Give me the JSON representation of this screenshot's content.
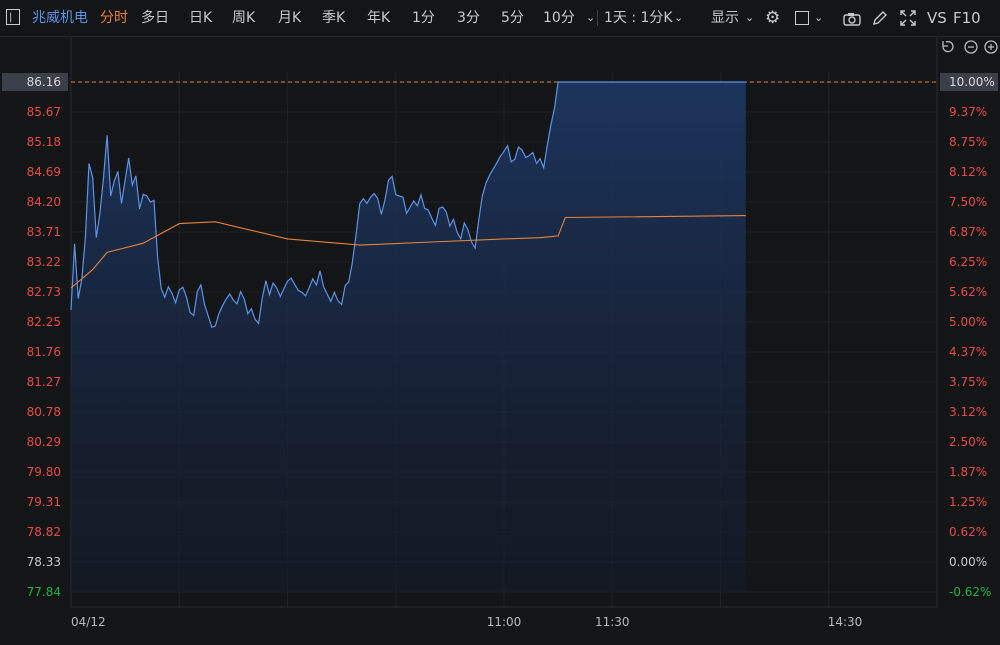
{
  "toolbar": {
    "stock_name": "兆威机电",
    "tabs": [
      "分时",
      "多日",
      "日K",
      "周K",
      "月K",
      "季K",
      "年K",
      "1分",
      "3分",
      "5分",
      "10分"
    ],
    "active_tab": "分时",
    "period_select": "1天 : 1分K",
    "display_label": "显示",
    "vs_label": "VS",
    "f10_label": "F10"
  },
  "colors": {
    "up": "#e84a4a",
    "down": "#22b14c",
    "neutral": "#c8c8c8",
    "price_line": "#5b93e6",
    "avg_line": "#e8813a",
    "limit_line": "#e8813a"
  },
  "chart_data": {
    "type": "line",
    "x_ticks": [
      "04/12",
      "11:00",
      "11:30",
      "14:30"
    ],
    "y_left_ticks": [
      "86.16",
      "85.67",
      "85.18",
      "84.69",
      "84.20",
      "83.71",
      "83.22",
      "82.73",
      "82.25",
      "81.76",
      "81.27",
      "80.78",
      "80.29",
      "79.80",
      "79.31",
      "78.82",
      "78.33",
      "77.84"
    ],
    "y_right_ticks": [
      "10.00%",
      "9.37%",
      "8.75%",
      "8.12%",
      "7.50%",
      "6.87%",
      "6.25%",
      "5.62%",
      "5.00%",
      "4.37%",
      "3.75%",
      "3.12%",
      "2.50%",
      "1.87%",
      "1.25%",
      "0.62%",
      "0.00%",
      "-0.62%"
    ],
    "ylim": [
      77.84,
      86.16
    ],
    "prev_close": 78.33,
    "limit_up": 86.16,
    "x_minutes_total": 240,
    "series": [
      {
        "kind": "price",
        "x": [
          0,
          1,
          2,
          3,
          4,
          5,
          6,
          7,
          8,
          9,
          10,
          11,
          12,
          13,
          14,
          15,
          16,
          17,
          18,
          19,
          20,
          21,
          22,
          23,
          24,
          25,
          26,
          27,
          28,
          29,
          30,
          31,
          32,
          33,
          34,
          35,
          36,
          37,
          38,
          39,
          40,
          41,
          42,
          43,
          44,
          45,
          46,
          47,
          48,
          49,
          50,
          51,
          52,
          53,
          54,
          55,
          56,
          57,
          58,
          59,
          60,
          61,
          62,
          63,
          64,
          65,
          66,
          67,
          68,
          69,
          70,
          71,
          72,
          73,
          74,
          75,
          76,
          77,
          78,
          79,
          80,
          81,
          82,
          83,
          84,
          85,
          86,
          87,
          88,
          89,
          90,
          91,
          92,
          93,
          94,
          95,
          96,
          97,
          98,
          99,
          100,
          101,
          102,
          103,
          104,
          105,
          106,
          107,
          108,
          109,
          110,
          111,
          112,
          113,
          114,
          115,
          116,
          117,
          118,
          119,
          120,
          121,
          122,
          123,
          124,
          125,
          126,
          127,
          128,
          129,
          130,
          131,
          132,
          133,
          134,
          135,
          136,
          137,
          138,
          139,
          140,
          141,
          142,
          143,
          144,
          145,
          146,
          147,
          148,
          149,
          150,
          151,
          152,
          153,
          154,
          155,
          156,
          157,
          158,
          159,
          160,
          161,
          162,
          163,
          164,
          165,
          166,
          167,
          168,
          169,
          170,
          171,
          172,
          173,
          174,
          175,
          176,
          177,
          178,
          179,
          180,
          181,
          182,
          183,
          184,
          185,
          186,
          187
        ],
        "values": [
          82.44,
          83.52,
          82.63,
          82.94,
          83.63,
          84.83,
          84.6,
          83.62,
          84.02,
          84.6,
          85.29,
          84.3,
          84.55,
          84.7,
          84.18,
          84.56,
          84.92,
          84.48,
          84.63,
          84.09,
          84.33,
          84.3,
          84.2,
          84.23,
          83.3,
          82.79,
          82.65,
          82.82,
          82.71,
          82.56,
          82.77,
          82.81,
          82.65,
          82.4,
          82.35,
          82.74,
          82.85,
          82.53,
          82.35,
          82.16,
          82.18,
          82.38,
          82.51,
          82.62,
          82.7,
          82.6,
          82.54,
          82.74,
          82.62,
          82.38,
          82.46,
          82.29,
          82.22,
          82.63,
          82.92,
          82.69,
          82.88,
          82.8,
          82.66,
          82.79,
          82.91,
          82.96,
          82.86,
          82.76,
          82.73,
          82.67,
          82.8,
          82.95,
          82.85,
          83.08,
          82.82,
          82.7,
          82.58,
          82.73,
          82.59,
          82.53,
          82.84,
          82.9,
          83.22,
          83.67,
          84.17,
          84.26,
          84.18,
          84.28,
          84.34,
          84.26,
          84.0,
          84.23,
          84.56,
          84.62,
          84.32,
          84.3,
          84.28,
          84.02,
          84.12,
          84.22,
          84.14,
          84.32,
          84.1,
          84.07,
          83.94,
          83.82,
          84.1,
          84.12,
          84.04,
          83.81,
          83.92,
          83.71,
          83.6,
          83.86,
          83.75,
          83.55,
          83.45,
          83.9,
          84.3,
          84.51,
          84.64,
          84.74,
          84.84,
          84.95,
          85.03,
          85.12,
          84.86,
          84.9,
          85.1,
          85.05,
          84.93,
          84.96,
          85.01,
          84.83,
          84.91,
          84.76,
          85.13,
          85.46,
          85.73,
          86.16,
          86.16,
          86.16,
          86.16,
          86.16,
          86.16,
          86.16,
          86.16,
          86.16,
          86.16,
          86.16,
          86.16,
          86.16,
          86.16,
          86.16,
          86.16,
          86.16,
          86.16,
          86.16,
          86.16,
          86.16,
          86.16,
          86.16,
          86.16,
          86.16,
          86.16,
          86.16,
          86.16,
          86.16,
          86.16,
          86.16,
          86.16,
          86.16,
          86.16,
          86.16,
          86.16,
          86.16,
          86.16,
          86.16,
          86.16,
          86.16,
          86.16,
          86.16,
          86.16,
          86.16,
          86.16,
          86.16,
          86.16,
          86.16,
          86.16,
          86.16,
          86.16,
          86.16
        ]
      },
      {
        "kind": "avg",
        "x": [
          0,
          6,
          10,
          20,
          30,
          40,
          60,
          80,
          100,
          120,
          130,
          135,
          137,
          187
        ],
        "values": [
          82.8,
          83.1,
          83.38,
          83.53,
          83.85,
          83.88,
          83.6,
          83.5,
          83.55,
          83.6,
          83.62,
          83.65,
          83.95,
          83.98
        ]
      }
    ]
  }
}
